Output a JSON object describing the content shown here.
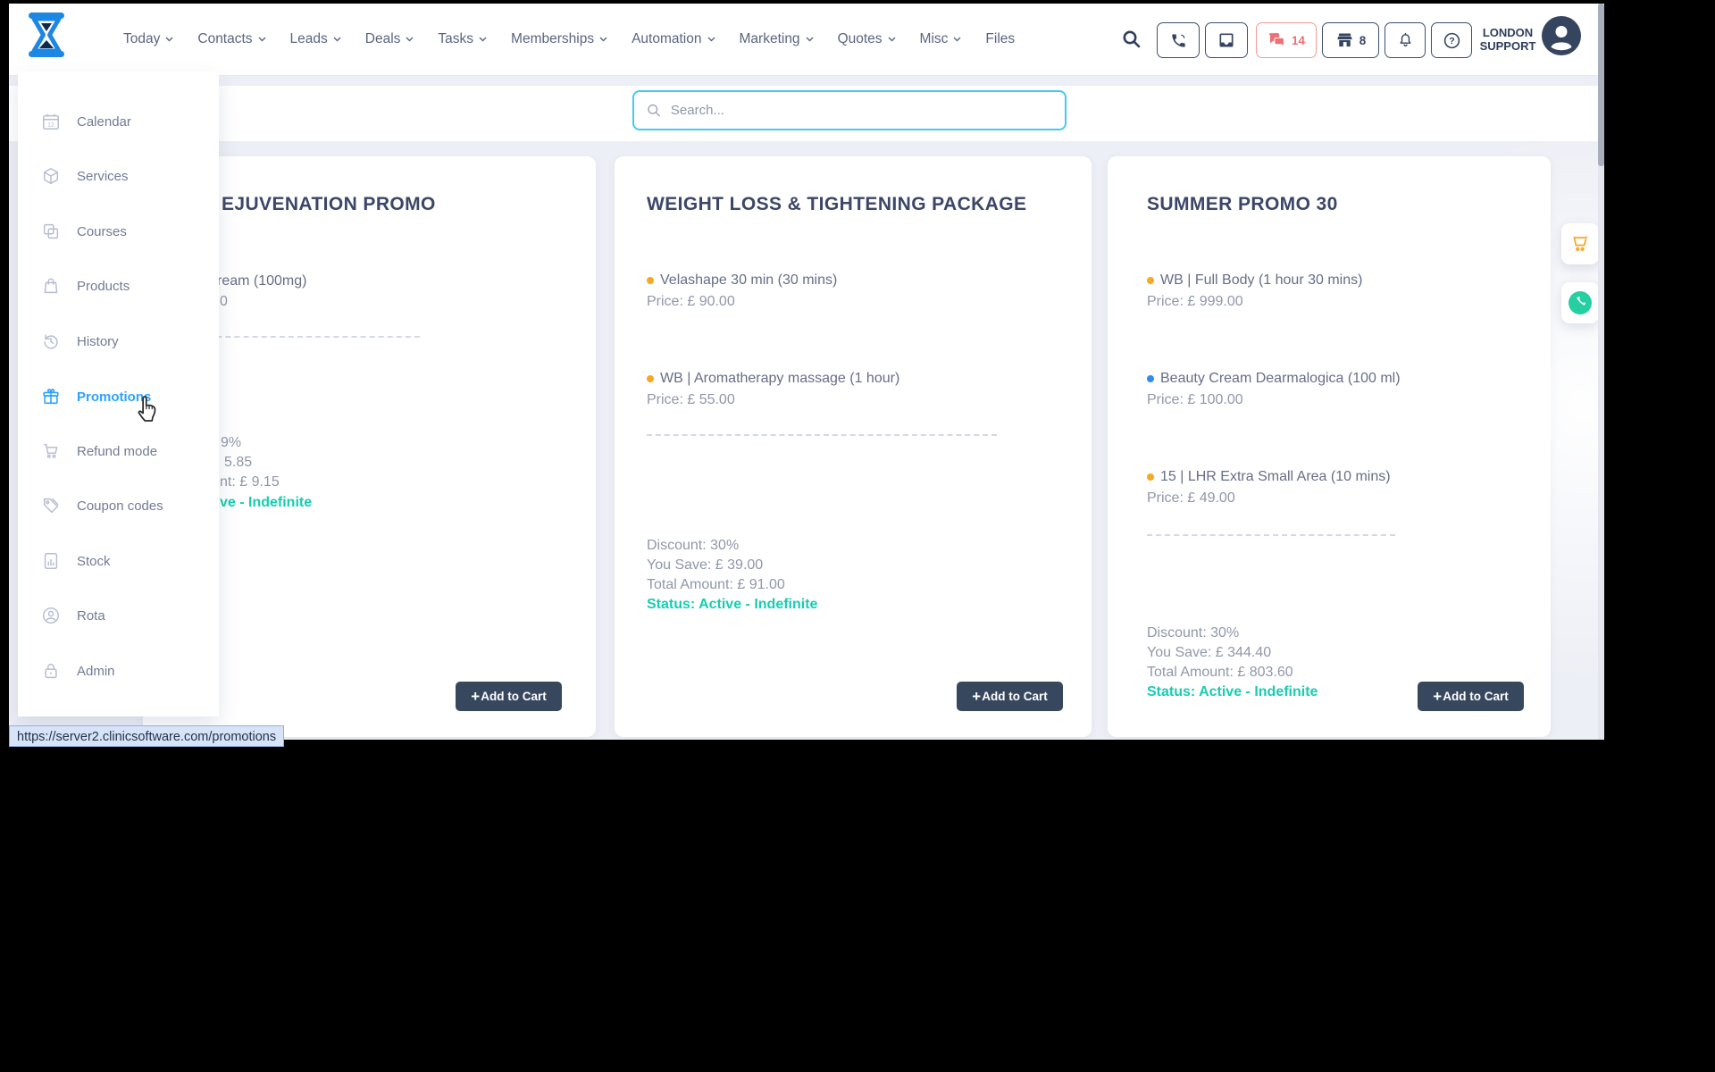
{
  "topbar": {
    "nav_items": [
      {
        "label": "Today",
        "chevron": true
      },
      {
        "label": "Contacts",
        "chevron": true
      },
      {
        "label": "Leads",
        "chevron": true
      },
      {
        "label": "Deals",
        "chevron": true
      },
      {
        "label": "Tasks",
        "chevron": true
      },
      {
        "label": "Memberships",
        "chevron": true
      },
      {
        "label": "Automation",
        "chevron": true
      },
      {
        "label": "Marketing",
        "chevron": true
      },
      {
        "label": "Quotes",
        "chevron": true
      },
      {
        "label": "Misc",
        "chevron": true
      },
      {
        "label": "Files",
        "chevron": false
      }
    ],
    "messages_count": "14",
    "basket_count": "8",
    "user_location_line1": "LONDON",
    "user_location_line2": "SUPPORT"
  },
  "search": {
    "placeholder": "Search..."
  },
  "sidebar": {
    "items": [
      {
        "label": "Calendar",
        "icon": "calendar-icon"
      },
      {
        "label": "Services",
        "icon": "services-cube-icon"
      },
      {
        "label": "Courses",
        "icon": "courses-icon"
      },
      {
        "label": "Products",
        "icon": "products-bag-icon"
      },
      {
        "label": "History",
        "icon": "history-clock-icon"
      },
      {
        "label": "Promotions",
        "icon": "promotions-gift-icon",
        "active": true
      },
      {
        "label": "Refund mode",
        "icon": "refund-cart-icon"
      },
      {
        "label": "Coupon codes",
        "icon": "coupon-tag-icon"
      },
      {
        "label": "Stock",
        "icon": "stock-chart-icon"
      },
      {
        "label": "Rota",
        "icon": "rota-person-icon"
      },
      {
        "label": "Admin",
        "icon": "admin-lock-icon"
      }
    ]
  },
  "cards": {
    "card1": {
      "title_fragment": "EJUVENATION PROMO",
      "item_name_fragment": "ream (100mg)",
      "item_price_fragment": "0",
      "discount_fragment": "9%",
      "you_save_fragment": "5.85",
      "total_fragment": "nt: £ 9.15",
      "status_fragment": "ve - Indefinite",
      "add_plus": "+",
      "add_label": "Add to Cart"
    },
    "card2": {
      "title": "WEIGHT LOSS & TIGHTENING PACKAGE",
      "items": [
        {
          "name": "Velashape 30 min (30 mins)",
          "price": "Price: £ 90.00",
          "bullet": "orange"
        },
        {
          "name": "WB | Aromatherapy massage (1 hour)",
          "price": "Price: £ 55.00",
          "bullet": "orange"
        }
      ],
      "discount": "Discount: 30%",
      "you_save": "You Save: £ 39.00",
      "total": "Total Amount: £ 91.00",
      "status": "Status: Active - Indefinite",
      "add_plus": "+",
      "add_label": "Add to Cart"
    },
    "card3": {
      "title": "SUMMER PROMO 30",
      "items": [
        {
          "name": "WB | Full Body (1 hour 30 mins)",
          "price": "Price: £ 999.00",
          "bullet": "orange"
        },
        {
          "name": "Beauty Cream Dearmalogica (100 ml)",
          "price": "Price: £ 100.00",
          "bullet": "blue"
        },
        {
          "name": "15 | LHR Extra Small Area (10 mins)",
          "price": "Price: £ 49.00",
          "bullet": "orange"
        }
      ],
      "discount": "Discount: 30%",
      "you_save": "You Save: £ 344.40",
      "total": "Total Amount: £ 803.60",
      "status": "Status: Active - Indefinite",
      "add_plus": "+",
      "add_label": "Add to Cart"
    }
  },
  "status_bar": {
    "url": "https://server2.clinicsoftware.com/promotions"
  },
  "colors": {
    "accent_blue": "#2da2ff",
    "teal_status": "#19ccb0",
    "salmon_alert": "#ee6f75",
    "navy": "#35455f",
    "orange_bullet": "#f7a823",
    "blue_bullet": "#2e8bf0",
    "search_border": "#45c9f2",
    "page_bg": "#edeff6",
    "button_bg": "#37485e"
  }
}
